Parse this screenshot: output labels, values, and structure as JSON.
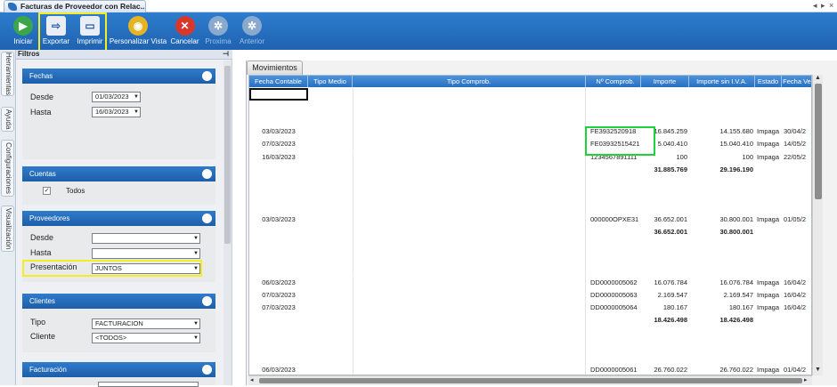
{
  "window": {
    "title": "Facturas de Proveedor con Relac..."
  },
  "ribbon": [
    {
      "label": "Iniciar",
      "icon": "play-icon",
      "color": "#3aa64a",
      "enabled": true
    },
    {
      "label": "Exportar",
      "icon": "export-icon",
      "color": "#e9eef6",
      "enabled": true
    },
    {
      "label": "Imprimir",
      "icon": "printer-icon",
      "color": "#e9eef6",
      "enabled": true
    },
    {
      "label": "Personalizar Vista",
      "icon": "customize-view-icon",
      "color": "#e5b421",
      "enabled": true
    },
    {
      "label": "Cancelar",
      "icon": "cancel-icon",
      "color": "#d8382c",
      "enabled": true
    },
    {
      "label": "Proxima",
      "icon": "next-icon",
      "color": "#8aa9cf",
      "enabled": false
    },
    {
      "label": "Anterior",
      "icon": "previous-icon",
      "color": "#8aa9cf",
      "enabled": false
    }
  ],
  "side_tabs": [
    "Herramientas",
    "Ayuda",
    "Configuraciones",
    "Visualización"
  ],
  "filters": {
    "title": "Filtros",
    "fechas": {
      "header": "Fechas",
      "desde_label": "Desde",
      "desde": "01/03/2023",
      "hasta_label": "Hasta",
      "hasta": "16/03/2023"
    },
    "cuentas": {
      "header": "Cuentas",
      "todos_label": "Todos",
      "todos_checked": true
    },
    "proveedores": {
      "header": "Proveedores",
      "desde_label": "Desde",
      "desde": "",
      "hasta_label": "Hasta",
      "hasta": "",
      "presentacion_label": "Presentación",
      "presentacion": "JUNTOS"
    },
    "clientes": {
      "header": "Clientes",
      "tipo_label": "Tipo",
      "tipo": "FACTURACION",
      "cliente_label": "Cliente",
      "cliente": "<TODOS>"
    },
    "facturacion": {
      "header": "Facturación"
    }
  },
  "main": {
    "tab": "Movimientos",
    "columns": [
      "Fecha Contable",
      "Tipo Medio",
      "Tipo Comprob.",
      "Nº Comprob.",
      "Importe",
      "Importe sin I.V.A.",
      "Estado",
      "Fecha Ve"
    ],
    "rows": [
      [
        "",
        "",
        "",
        "",
        "",
        "",
        "",
        ""
      ],
      [
        "",
        "",
        "",
        "",
        "",
        "",
        "",
        ""
      ],
      [
        "",
        "",
        "",
        "",
        "",
        "",
        "",
        ""
      ],
      [
        "03/03/2023",
        "",
        "",
        "FE3932520918",
        "16.845.259",
        "14.155.680",
        "Impaga",
        "30/04/2"
      ],
      [
        "07/03/2023",
        "",
        "",
        "FE03932515421",
        "5.040.410",
        "15.040.410",
        "Impaga",
        "14/05/2"
      ],
      [
        "16/03/2023",
        "",
        "",
        "1234567891111",
        "100",
        "100",
        "Impaga",
        "22/05/2"
      ],
      [
        "",
        "",
        "",
        "",
        "31.885.769",
        "29.196.190",
        "",
        ""
      ],
      [
        "",
        "",
        "",
        "",
        "",
        "",
        "",
        ""
      ],
      [
        "",
        "",
        "",
        "",
        "",
        "",
        "",
        ""
      ],
      [
        "",
        "",
        "",
        "",
        "",
        "",
        "",
        ""
      ],
      [
        "03/03/2023",
        "",
        "",
        "000000OPXE31",
        "36.652.001",
        "30.800.001",
        "Impaga",
        "01/05/2"
      ],
      [
        "",
        "",
        "",
        "",
        "36.652.001",
        "30.800.001",
        "",
        ""
      ],
      [
        "",
        "",
        "",
        "",
        "",
        "",
        "",
        ""
      ],
      [
        "",
        "",
        "",
        "",
        "",
        "",
        "",
        ""
      ],
      [
        "",
        "",
        "",
        "",
        "",
        "",
        "",
        ""
      ],
      [
        "06/03/2023",
        "",
        "",
        "DD0000005062",
        "16.076.784",
        "16.076.784",
        "Impaga",
        "16/04/2"
      ],
      [
        "07/03/2023",
        "",
        "",
        "DD0000005063",
        "2.169.547",
        "2.169.547",
        "Impaga",
        "16/04/2"
      ],
      [
        "07/03/2023",
        "",
        "",
        "DD0000005064",
        "180.167",
        "180.167",
        "Impaga",
        "16/04/2"
      ],
      [
        "",
        "",
        "",
        "",
        "18.426.498",
        "18.426.498",
        "",
        ""
      ],
      [
        "",
        "",
        "",
        "",
        "",
        "",
        "",
        ""
      ],
      [
        "",
        "",
        "",
        "",
        "",
        "",
        "",
        ""
      ],
      [
        "",
        "",
        "",
        "",
        "",
        "",
        "",
        ""
      ],
      [
        "06/03/2023",
        "",
        "",
        "DD0000005061",
        "26.760.022",
        "26.760.022",
        "Impaga",
        "01/04/2"
      ],
      [
        "",
        "",
        "",
        "",
        "26.760.022",
        "26.760.022",
        "",
        ""
      ]
    ]
  }
}
